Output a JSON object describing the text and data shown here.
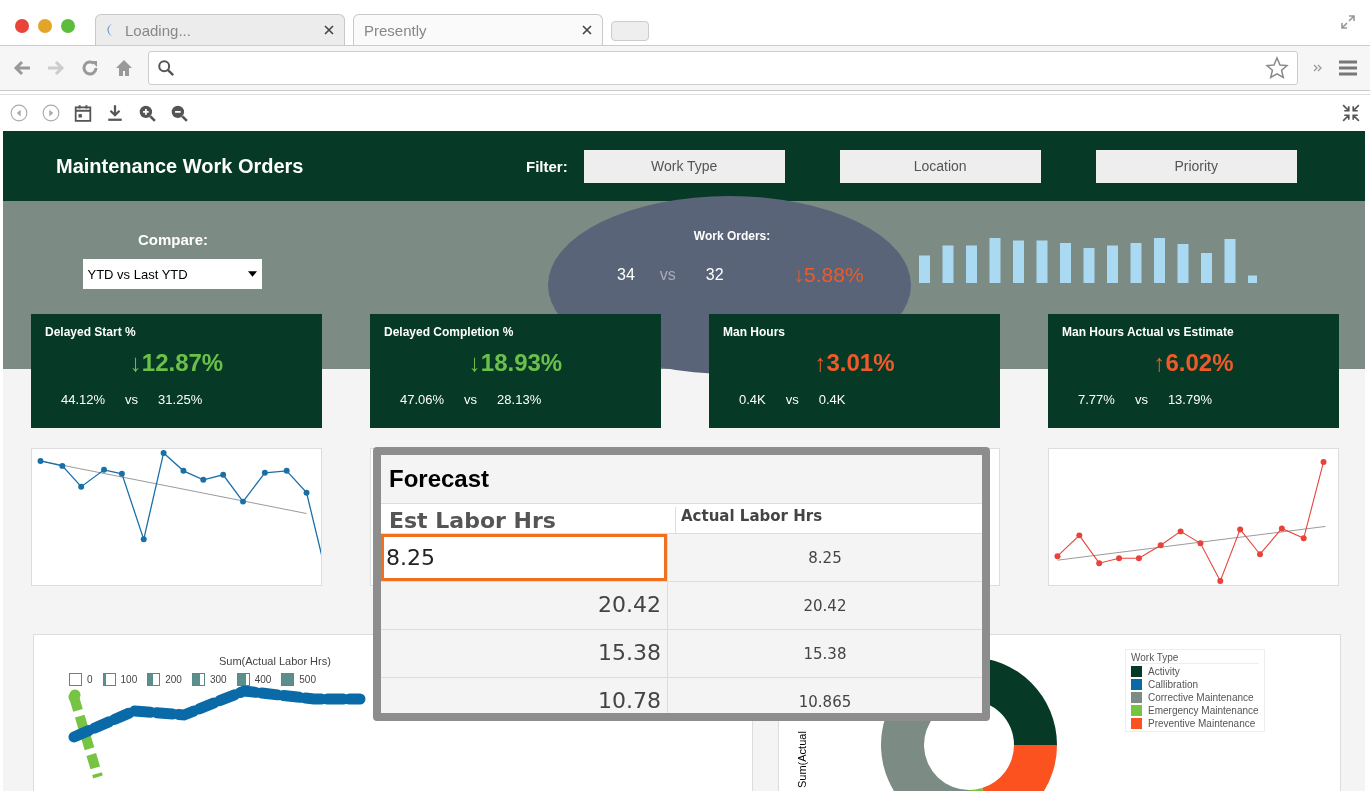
{
  "browser": {
    "tabs": [
      {
        "title": "Loading...",
        "selected": false,
        "loading": true
      },
      {
        "title": "Presently",
        "selected": true,
        "loading": false
      }
    ]
  },
  "dashboard": {
    "title": "Maintenance Work Orders",
    "filter_label": "Filter:",
    "filters": [
      "Work Type",
      "Location",
      "Priority"
    ],
    "compare": {
      "label": "Compare:",
      "value": "YTD vs Last YTD"
    },
    "work_orders": {
      "label": "Work Orders:",
      "current": "34",
      "vs": "vs",
      "previous": "32",
      "change": "↓5.88%",
      "color": "#f05a28"
    },
    "kpis": [
      {
        "title": "Delayed Start %",
        "change": "↓12.87%",
        "color": "#6cc04a",
        "current": "44.12%",
        "vs": "vs",
        "previous": "31.25%"
      },
      {
        "title": "Delayed Completion %",
        "change": "↓18.93%",
        "color": "#6cc04a",
        "current": "47.06%",
        "vs": "vs",
        "previous": "28.13%"
      },
      {
        "title": "Man Hours",
        "change": "↑3.01%",
        "color": "#f05a28",
        "current": "0.4K",
        "vs": "vs",
        "previous": "0.4K"
      },
      {
        "title": "Man Hours Actual vs Estimate",
        "change": "↑6.02%",
        "color": "#f05a28",
        "current": "7.77%",
        "vs": "vs",
        "previous": "13.79%"
      }
    ],
    "map_chart": {
      "legend_title": "Sum(Actual  Labor Hrs)",
      "legend": [
        {
          "label": "0",
          "level": 0
        },
        {
          "label": "100",
          "level": 0.2
        },
        {
          "label": "200",
          "level": 0.4
        },
        {
          "label": "300",
          "level": 0.6
        },
        {
          "label": "400",
          "level": 0.8
        },
        {
          "label": "500",
          "level": 1
        }
      ]
    },
    "donut_chart": {
      "axis_label": "Sum(Actual",
      "legend_title": "Work Type",
      "legend": [
        {
          "label": "Activity",
          "color": "#063a26"
        },
        {
          "label": "Callibration",
          "color": "#0a6aa8"
        },
        {
          "label": "Corrective Maintenance",
          "color": "#7c8b84"
        },
        {
          "label": "Emergency Maintenance",
          "color": "#76c442"
        },
        {
          "label": "Preventive Maintenance",
          "color": "#fc5220"
        }
      ]
    },
    "forecast": {
      "title": "Forecast",
      "columns": [
        "Est Labor Hrs",
        "Actual Labor Hrs"
      ],
      "rows": [
        {
          "est": "8.25",
          "actual": "8.25",
          "selected": true
        },
        {
          "est": "20.42",
          "actual": "20.42",
          "selected": false
        },
        {
          "est": "15.38",
          "actual": "15.38",
          "selected": false
        },
        {
          "est": "10.78",
          "actual": "10.865",
          "selected": false
        }
      ]
    }
  }
}
